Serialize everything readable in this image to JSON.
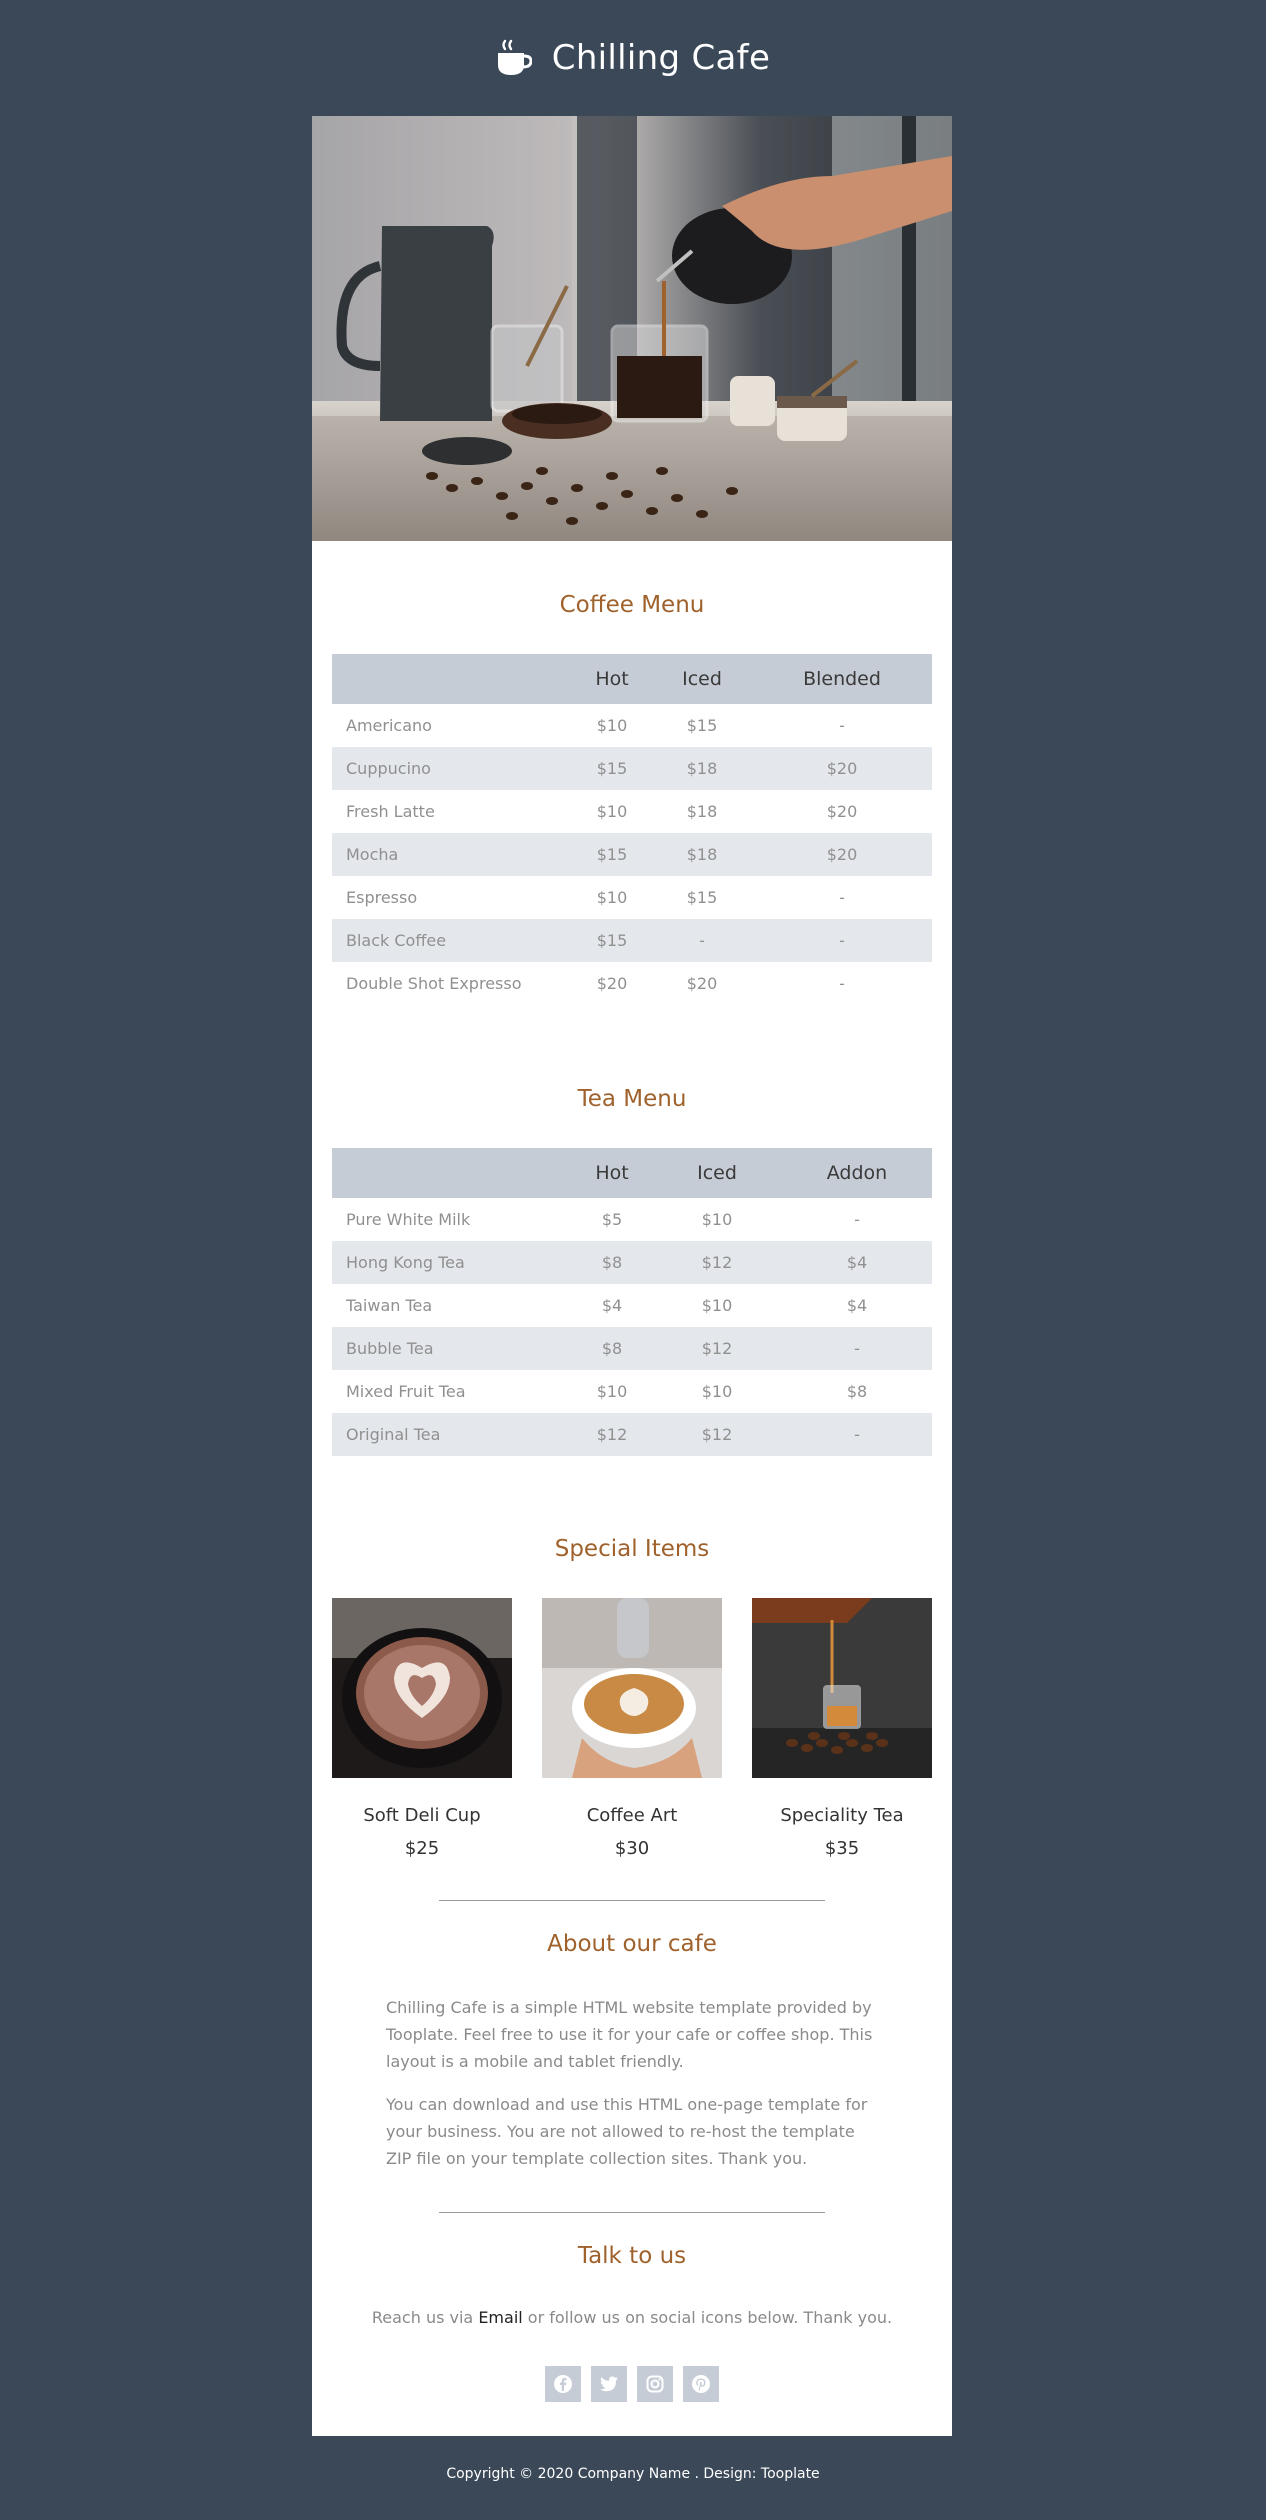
{
  "header": {
    "title": "Chilling Cafe",
    "icon": "coffee-cup-icon"
  },
  "coffee_menu": {
    "title": "Coffee Menu",
    "columns": [
      "",
      "Hot",
      "Iced",
      "Blended"
    ],
    "rows": [
      [
        "Americano",
        "$10",
        "$15",
        "-"
      ],
      [
        "Cuppucino",
        "$15",
        "$18",
        "$20"
      ],
      [
        "Fresh Latte",
        "$10",
        "$18",
        "$20"
      ],
      [
        "Mocha",
        "$15",
        "$18",
        "$20"
      ],
      [
        "Espresso",
        "$10",
        "$15",
        "-"
      ],
      [
        "Black Coffee",
        "$15",
        "-",
        "-"
      ],
      [
        "Double Shot Expresso",
        "$20",
        "$20",
        "-"
      ]
    ]
  },
  "tea_menu": {
    "title": "Tea Menu",
    "columns": [
      "",
      "Hot",
      "Iced",
      "Addon"
    ],
    "rows": [
      [
        "Pure White Milk",
        "$5",
        "$10",
        "-"
      ],
      [
        "Hong Kong Tea",
        "$8",
        "$12",
        "$4"
      ],
      [
        "Taiwan Tea",
        "$4",
        "$10",
        "$4"
      ],
      [
        "Bubble Tea",
        "$8",
        "$12",
        "-"
      ],
      [
        "Mixed Fruit Tea",
        "$10",
        "$10",
        "$8"
      ],
      [
        "Original Tea",
        "$12",
        "$12",
        "-"
      ]
    ]
  },
  "specials": {
    "title": "Special Items",
    "items": [
      {
        "name": "Soft Deli Cup",
        "price": "$25"
      },
      {
        "name": "Coffee Art",
        "price": "$30"
      },
      {
        "name": "Speciality Tea",
        "price": "$35"
      }
    ]
  },
  "about": {
    "title": "About our cafe",
    "paragraphs": [
      "Chilling Cafe is a simple HTML website template provided by Tooplate. Feel free to use it for your cafe or coffee shop. This layout is a mobile and tablet friendly.",
      "You can download and use this HTML one-page template for your business. You are not allowed to re-host the template ZIP file on your template collection sites. Thank you."
    ]
  },
  "talk": {
    "title": "Talk to us",
    "text_before": "Reach us via ",
    "email_link": "Email",
    "text_after": " or follow us on social icons below. Thank you.",
    "socials": [
      "facebook-icon",
      "twitter-icon",
      "instagram-icon",
      "pinterest-icon"
    ]
  },
  "footer": {
    "text": "Copyright © 2020 Company Name . Design: Tooplate"
  },
  "colors": {
    "background": "#3a4858",
    "accent": "#a0622d",
    "table_header": "#c6ccd6",
    "table_alt_row": "#e4e7ec"
  }
}
